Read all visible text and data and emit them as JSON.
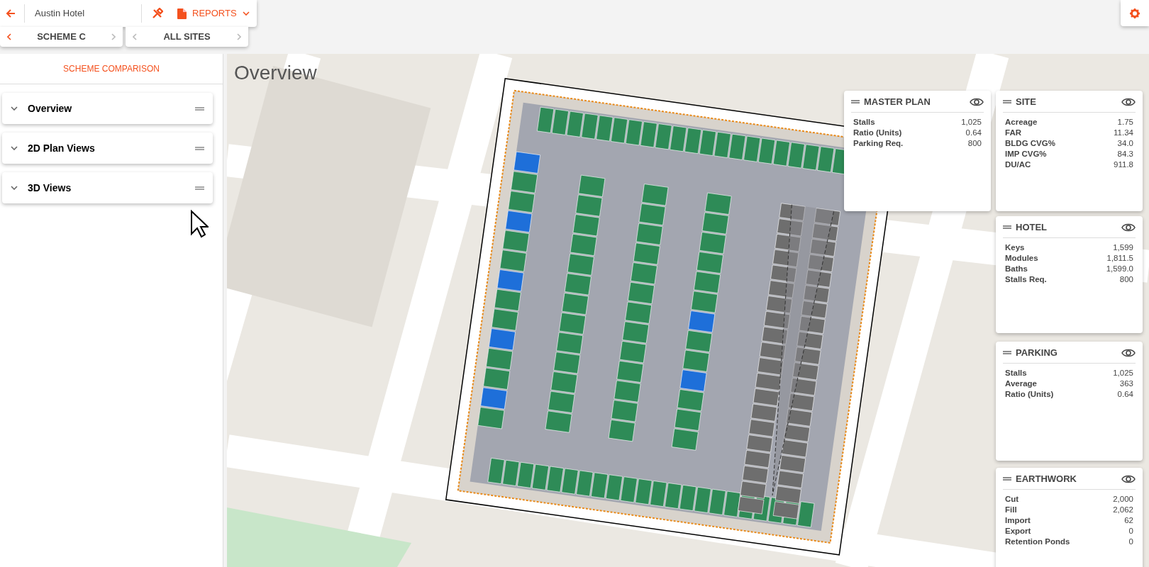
{
  "top_bar": {
    "title": "Austin Hotel",
    "reports_label": "REPORTS"
  },
  "selectors": [
    {
      "label": "SCHEME C",
      "prev_enabled": true,
      "next_enabled": false
    },
    {
      "label": "ALL SITES",
      "prev_enabled": false,
      "next_enabled": false
    }
  ],
  "sidebar": {
    "heading": "SCHEME COMPARISON",
    "items": [
      {
        "label": "Overview",
        "expanded": false
      },
      {
        "label": "2D Plan Views",
        "expanded": false
      },
      {
        "label": "3D Views",
        "expanded": false
      }
    ]
  },
  "map": {
    "title": "Overview"
  },
  "panels": [
    {
      "title": "MASTER PLAN",
      "visible": true,
      "rows": [
        {
          "label": "Stalls",
          "value": "1,025"
        },
        {
          "label": "Ratio (Units)",
          "value": "0.64"
        },
        {
          "label": "Parking Req.",
          "value": "800"
        }
      ]
    },
    {
      "title": "SITE",
      "visible": true,
      "rows": [
        {
          "label": "Acreage",
          "value": "1.75"
        },
        {
          "label": "FAR",
          "value": "11.34"
        },
        {
          "label": "BLDG CVG%",
          "value": "34.0"
        },
        {
          "label": "IMP CVG%",
          "value": "84.3"
        },
        {
          "label": "DU/AC",
          "value": "911.8"
        }
      ]
    },
    {
      "title": "HOTEL",
      "visible": true,
      "rows": [
        {
          "label": "Keys",
          "value": "1,599"
        },
        {
          "label": "Modules",
          "value": "1,811.5"
        },
        {
          "label": "Baths",
          "value": "1,599.0"
        },
        {
          "label": "Stalls Req.",
          "value": "800"
        }
      ]
    },
    {
      "title": "PARKING",
      "visible": true,
      "rows": [
        {
          "label": "Stalls",
          "value": "1,025"
        },
        {
          "label": "Average",
          "value": "363"
        },
        {
          "label": "Ratio (Units)",
          "value": "0.64"
        }
      ]
    },
    {
      "title": "EARTHWORK",
      "visible": true,
      "rows": [
        {
          "label": "Cut",
          "value": "2,000"
        },
        {
          "label": "Fill",
          "value": "2,062"
        },
        {
          "label": "Import",
          "value": "62"
        },
        {
          "label": "Export",
          "value": "0"
        },
        {
          "label": "Retention Ponds",
          "value": "0"
        }
      ]
    }
  ]
}
